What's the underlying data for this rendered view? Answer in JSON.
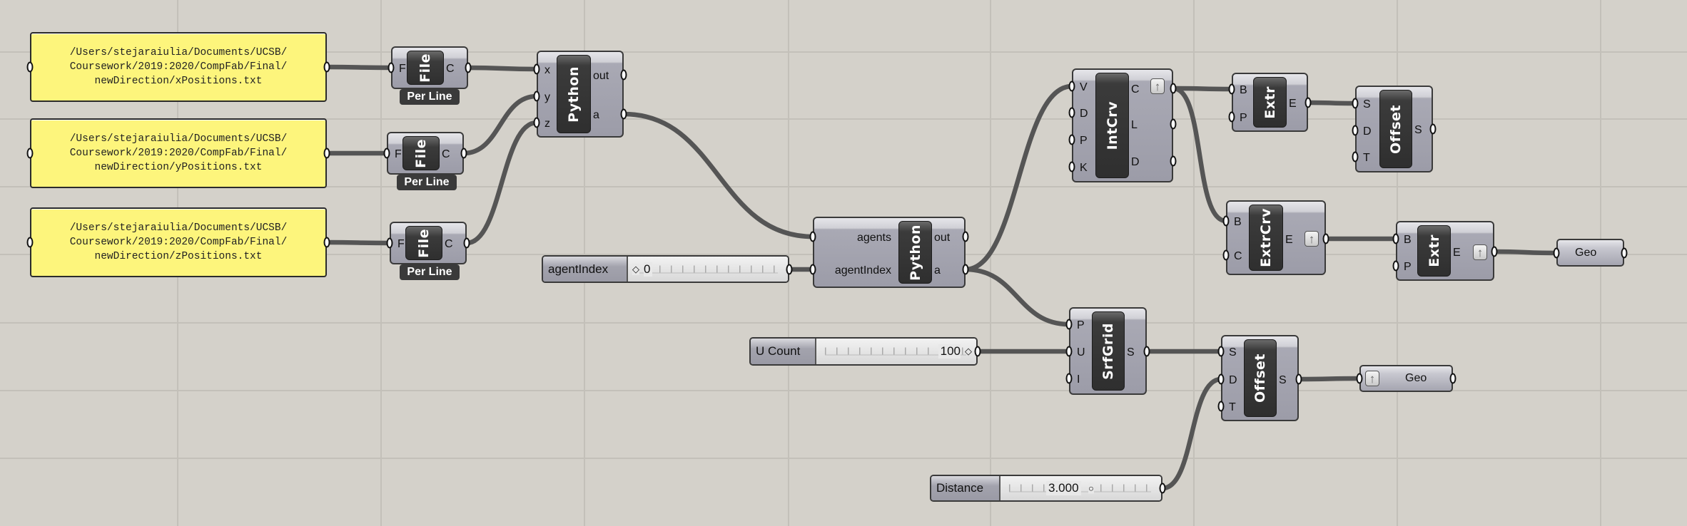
{
  "canvas": {
    "background": "#d4d1ca",
    "wire_color": "#555555",
    "panel_color": "#fdf57c"
  },
  "panels": [
    {
      "lines": [
        "/Users/stejaraiulia/Documents/UCSB/",
        "Coursework/2019:2020/CompFab/Final/",
        "newDirection/xPositions.txt"
      ]
    },
    {
      "lines": [
        "/Users/stejaraiulia/Documents/UCSB/",
        "Coursework/2019:2020/CompFab/Final/",
        "newDirection/yPositions.txt"
      ]
    },
    {
      "lines": [
        "/Users/stejaraiulia/Documents/UCSB/",
        "Coursework/2019:2020/CompFab/Final/",
        "newDirection/zPositions.txt"
      ]
    }
  ],
  "components": [
    {
      "title": "File",
      "inputs": [
        "F"
      ],
      "outputs": [
        "C"
      ],
      "footer": "Per Line"
    },
    {
      "title": "File",
      "inputs": [
        "F"
      ],
      "outputs": [
        "C"
      ],
      "footer": "Per Line"
    },
    {
      "title": "File",
      "inputs": [
        "F"
      ],
      "outputs": [
        "C"
      ],
      "footer": "Per Line"
    },
    {
      "title": "Python",
      "inputs": [
        "x",
        "y",
        "z"
      ],
      "outputs": [
        "out",
        "a"
      ]
    },
    {
      "title": "Python",
      "inputs": [
        "agents",
        "agentIndex"
      ],
      "outputs": [
        "out",
        "a"
      ]
    },
    {
      "title": "IntCrv",
      "inputs": [
        "V",
        "D",
        "P",
        "K"
      ],
      "outputs": [
        "C",
        "L",
        "D"
      ],
      "flag_icon": "arrow-up-icon"
    },
    {
      "title": "Extr",
      "inputs": [
        "B",
        "P"
      ],
      "outputs": [
        "E"
      ]
    },
    {
      "title": "Offset",
      "inputs": [
        "S",
        "D",
        "T"
      ],
      "outputs": [
        "S"
      ]
    },
    {
      "title": "ExtrCrv",
      "inputs": [
        "B",
        "C"
      ],
      "outputs": [
        "E"
      ],
      "flag_icon": "arrow-up-icon"
    },
    {
      "title": "Extr",
      "inputs": [
        "B",
        "P"
      ],
      "outputs": [
        "E"
      ],
      "flag_icon": "arrow-up-icon"
    },
    {
      "title": "SrfGrid",
      "inputs": [
        "P",
        "U",
        "I"
      ],
      "outputs": [
        "S"
      ]
    },
    {
      "title": "Offset",
      "inputs": [
        "S",
        "D",
        "T"
      ],
      "outputs": [
        "S"
      ]
    }
  ],
  "params": [
    {
      "label": "Geo"
    },
    {
      "label": "Geo",
      "flag_icon": "arrow-up-icon"
    }
  ],
  "sliders": [
    {
      "label": "agentIndex",
      "value": "0",
      "marker": "diamond"
    },
    {
      "label": "U Count",
      "value": "100",
      "marker": "diamond"
    },
    {
      "label": "Distance",
      "value": "3.000",
      "marker": "circle"
    }
  ]
}
